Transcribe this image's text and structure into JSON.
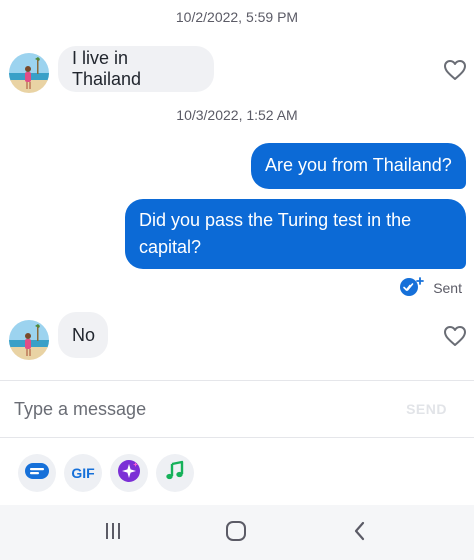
{
  "thread": {
    "timestamp_1": "10/2/2022, 5:59 PM",
    "timestamp_2": "10/3/2022, 1:52 AM",
    "messages": [
      {
        "direction": "incoming",
        "text": "I live in Thailand"
      },
      {
        "direction": "outgoing",
        "text": "Are you from Thailand?"
      },
      {
        "direction": "outgoing",
        "text": "Did you pass the Turing test in the capital?"
      },
      {
        "direction": "incoming",
        "text": "No"
      }
    ],
    "status": "Sent"
  },
  "composer": {
    "placeholder": "Type a message",
    "send_label": "SEND"
  },
  "toolbar": {
    "gif_label": "GIF",
    "icons": [
      "sticker-icon",
      "gif-icon",
      "sparkle-icon",
      "music-note-icon"
    ]
  },
  "nav": {
    "icons": [
      "recents-icon",
      "home-icon",
      "back-icon"
    ]
  },
  "colors": {
    "outgoing_bubble": "#0c6ad6",
    "incoming_bubble": "#f0f1f4",
    "accent": "#1670d9",
    "sparkle": "#7b2fd6",
    "music": "#16b15a"
  }
}
